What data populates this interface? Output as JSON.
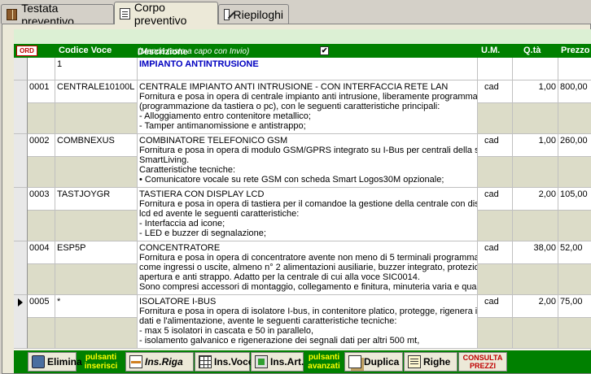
{
  "tabs": [
    {
      "label": "Testata preventivo",
      "icon": "book-icon",
      "active": false
    },
    {
      "label": "Corpo preventivo",
      "icon": "doc-icon",
      "active": true
    },
    {
      "label": "Riepiloghi",
      "icon": "edit-icon",
      "active": false
    }
  ],
  "grid": {
    "headers": {
      "ord": "ORD",
      "codice": "Codice Voce",
      "descrizione": "Descrizione",
      "hint": "(Manda testo a capo con Invio)",
      "um": "U.M.",
      "qta": "Q.tà",
      "prezzo": "Prezzo"
    },
    "wrap_checked": true,
    "group_row": {
      "code": "1",
      "title": "IMPIANTO ANTINTRUSIONE"
    },
    "rows": [
      {
        "num": "0001",
        "code": "CENTRALE10100L",
        "lines": [
          "CENTRALE IMPIANTO ANTI INTRUSIONE - CON INTERFACCIA RETE LAN",
          "Fornitura e posa in opera di centrale impianto anti intrusione, liberamente programmabile",
          "(programmazione da tastiera o pc), con le seguenti caratteristiche principali:",
          "- Alloggiamento entro contenitore metallico;",
          "- Tamper antimanomissione e antistrappo;"
        ],
        "um": "cad",
        "qta": "1,00",
        "prezzo": "800,00",
        "selected": false
      },
      {
        "num": "0002",
        "code": "COMBNEXUS",
        "lines": [
          "COMBINATORE TELEFONICO GSM",
          "Fornitura e posa in opera di modulo GSM/GPRS integrato su I-Bus per centrali della serie",
          "SmartLiving.",
          "Caratteristiche tecniche:",
          "• Comunicatore vocale su rete GSM con scheda Smart Logos30M opzionale;"
        ],
        "um": "cad",
        "qta": "1,00",
        "prezzo": "260,00",
        "selected": false
      },
      {
        "num": "0003",
        "code": "TASTJOYGR",
        "lines": [
          "TASTIERA CON DISPLAY LCD",
          "Fornitura e posa in opera di tastiera per il comandoe la gestione della centrale con display",
          "lcd ed avente le seguenti caratteristiche:",
          "- Interfaccia ad icone;",
          "- LED e buzzer di segnalazione;"
        ],
        "um": "cad",
        "qta": "2,00",
        "prezzo": "105,00",
        "selected": false
      },
      {
        "num": "0004",
        "code": "ESP5P",
        "lines": [
          "CONCENTRATORE",
          "Fornitura e posa in opera di concentratore avente non meno di 5 terminali programmabili",
          "come ingressi o uscite, almeno n° 2 alimentazioni ausiliarie, buzzer integrato, protezione anti",
          "apertura e anti strappo. Adatto per la centrale di cui alla voce SIC0014.",
          "Sono compresi accessori di montaggio, collegamento e finitura, minuteria varia e quant'altro"
        ],
        "um": "cad",
        "qta": "38,00",
        "prezzo": "52,00",
        "selected": false
      },
      {
        "num": "0005",
        "code": "*",
        "lines": [
          "ISOLATORE I-BUS",
          "Fornitura e posa in opera di isolatore I-bus, in contenitore platico,  protegge, rigenera il bus",
          "dati e l'alimentazione, avente le seguenti caratteristiche tecniche:",
          "- max 5 isolatori in cascata e 50 in parallelo,",
          "- isolamento galvanico e rigenerazione dei segnali dati per altri 500 mt,"
        ],
        "um": "cad",
        "qta": "2,00",
        "prezzo": "75,00",
        "selected": true
      }
    ]
  },
  "toolbar": {
    "elimina": "Elimina",
    "label_inserisci": [
      "pulsanti",
      "inserisci"
    ],
    "ins_riga": "Ins.Riga",
    "ins_voce": "Ins.Voce",
    "ins_art": "Ins.Art.",
    "label_avanzati": [
      "pulsanti",
      "avanzati"
    ],
    "duplica": "Duplica",
    "righe": "Righe",
    "consulta": [
      "CONSULTA",
      "PREZZI"
    ]
  },
  "colors": {
    "header_green": "#008000",
    "group_title_blue": "#0000c0",
    "toolbar_label_yellow": "#ffff00",
    "consulta_red": "#c00000"
  }
}
